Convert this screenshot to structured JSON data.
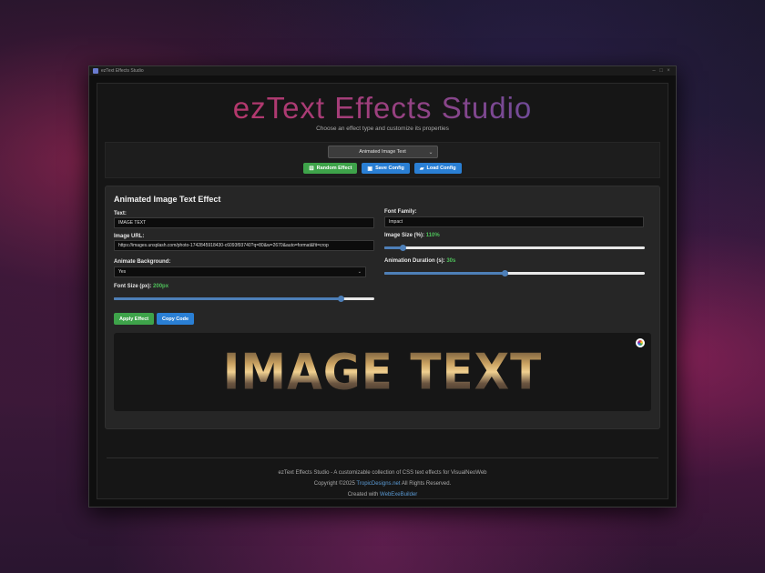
{
  "window": {
    "title": "ezText Effects Studio"
  },
  "header": {
    "title": "ezText Effects Studio",
    "subtitle": "Choose an effect type and customize its properties"
  },
  "toolbar": {
    "effect_select": "Animated Image Text",
    "random_label": "Random Effect",
    "save_label": "Save Config",
    "load_label": "Load Config"
  },
  "panel": {
    "title": "Animated Image Text Effect",
    "text_label": "Text:",
    "text_value": "IMAGE TEXT",
    "image_url_label": "Image URL:",
    "image_url_value": "https://images.unsplash.com/photo-1742845918430-c6093f93740?q=80&w=2670&auto=format&fit=crop",
    "animate_bg_label": "Animate Background:",
    "animate_bg_value": "Yes",
    "font_size_label": "Font Size (px):",
    "font_size_value": "200px",
    "font_size_fraction": 0.87,
    "font_family_label": "Font Family:",
    "font_family_value": "Impact",
    "image_size_label": "Image Size (%):",
    "image_size_value": "110%",
    "image_size_fraction": 0.07,
    "duration_label": "Animation Duration (s):",
    "duration_value": "30s",
    "duration_fraction": 0.46,
    "apply_label": "Apply Effect",
    "copy_label": "Copy Code",
    "preview_text": "IMAGE TEXT"
  },
  "footer": {
    "line1": "ezText Effects Studio - A customizable collection of CSS text effects for VisualNeoWeb",
    "line2_prefix": "Copyright ©2025",
    "line2_link": "TropicDesigns.net",
    "line2_suffix": "All Rights Reserved.",
    "line3_prefix": "Created with",
    "line3_link": "WebExeBuilder"
  },
  "colors": {
    "accent_green": "#3ea34a",
    "accent_blue": "#2a7fd4",
    "slider_blue": "#4d7fb8",
    "title_gradient_start": "#c8305c",
    "title_gradient_end": "#4a55b0"
  }
}
